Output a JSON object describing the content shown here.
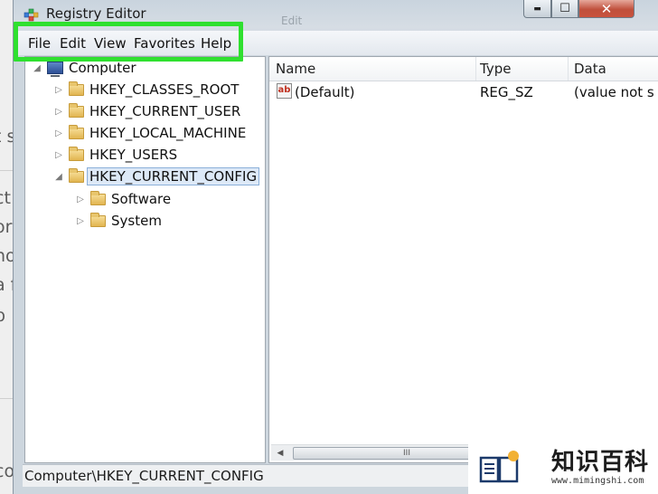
{
  "window": {
    "title": "Registry Editor",
    "ghost_text": "Edit"
  },
  "window_buttons": {
    "minimize": "▬",
    "maximize": "☐",
    "close": "✕"
  },
  "menu": [
    "File",
    "Edit",
    "View",
    "Favorites",
    "Help"
  ],
  "tree": {
    "root": "Computer",
    "items": [
      {
        "label": "HKEY_CLASSES_ROOT",
        "expanded": false
      },
      {
        "label": "HKEY_CURRENT_USER",
        "expanded": false
      },
      {
        "label": "HKEY_LOCAL_MACHINE",
        "expanded": false
      },
      {
        "label": "HKEY_USERS",
        "expanded": false
      },
      {
        "label": "HKEY_CURRENT_CONFIG",
        "expanded": true,
        "selected": true
      }
    ],
    "children": [
      {
        "label": "Software"
      },
      {
        "label": "System"
      }
    ]
  },
  "values": {
    "columns": [
      "Name",
      "Type",
      "Data"
    ],
    "rows": [
      {
        "name": "(Default)",
        "type": "REG_SZ",
        "data": "(value not s"
      }
    ],
    "icon_label": "ab"
  },
  "scroll_grip": "III",
  "status": "Computer\\HKEY_CURRENT_CONFIG",
  "background_fragments": [
    "t s",
    "ct",
    "or",
    "no",
    "a f",
    "p",
    "co"
  ],
  "watermark": {
    "title": "知识百科",
    "url": "www.mimingshi.com"
  },
  "colors": {
    "highlight": "#2fe02f",
    "close_button": "#c0503c"
  }
}
